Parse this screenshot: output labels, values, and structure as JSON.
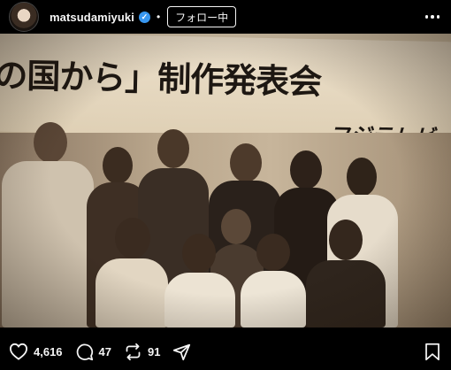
{
  "header": {
    "username": "matsudamiyuki",
    "verified_glyph": "✓",
    "separator": "•",
    "follow_label": "フォロー中"
  },
  "photo": {
    "banner_text": "の国から」制作発表会",
    "banner_sub": "フジテレビ"
  },
  "actions": {
    "likes": "4,616",
    "comments": "47",
    "reposts": "91"
  },
  "icons": {
    "like": "heart-icon",
    "comment": "comment-icon",
    "repost": "repost-icon",
    "share": "share-icon",
    "save": "bookmark-icon",
    "more": "more-icon"
  }
}
